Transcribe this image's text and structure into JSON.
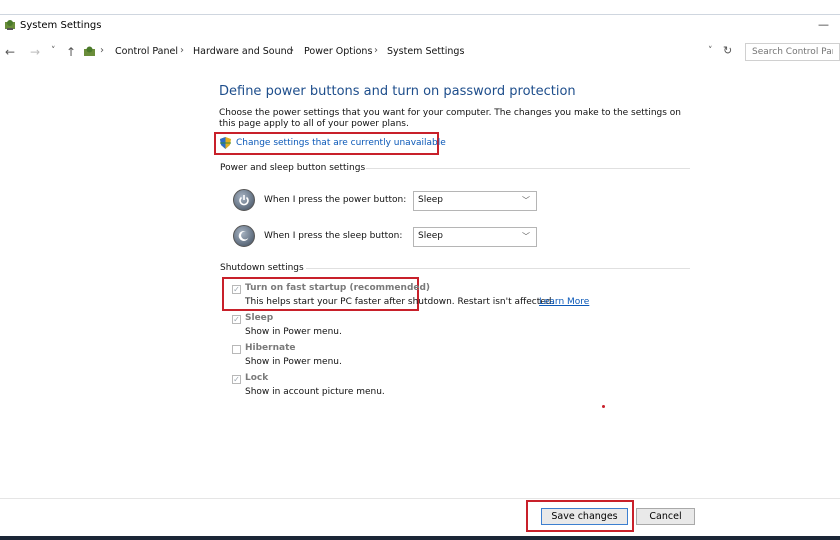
{
  "window": {
    "title": "System Settings",
    "minimize_glyph": "—"
  },
  "nav": {
    "back": "←",
    "forward": "→",
    "recent": "˅",
    "up": "↑",
    "refresh": "↻",
    "history": "˅"
  },
  "breadcrumb": [
    "Control Panel",
    "Hardware and Sound",
    "Power Options",
    "System Settings"
  ],
  "breadcrumb_sep": "›",
  "search": {
    "placeholder": "Search Control Par"
  },
  "main": {
    "heading": "Define power buttons and turn on password protection",
    "description": "Choose the power settings that you want for your computer. The changes you make to the settings on this page apply to all of your power plans.",
    "change_link": "Change settings that are currently unavailable"
  },
  "power_sleep": {
    "section_title": "Power and sleep button settings",
    "power_label": "When I press the power button:",
    "power_value": "Sleep",
    "sleep_label": "When I press the sleep button:",
    "sleep_value": "Sleep"
  },
  "shutdown": {
    "section_title": "Shutdown settings",
    "fast_startup": {
      "title": "Turn on fast startup (recommended)",
      "desc": "This helps start your PC faster after shutdown. Restart isn't affected.",
      "learn_more": "Learn More",
      "checked": true
    },
    "sleep": {
      "title": "Sleep",
      "desc": "Show in Power menu.",
      "checked": true
    },
    "hibernate": {
      "title": "Hibernate",
      "desc": "Show in Power menu.",
      "checked": false
    },
    "lock": {
      "title": "Lock",
      "desc": "Show in account picture menu.",
      "checked": true
    }
  },
  "buttons": {
    "save": "Save changes",
    "cancel": "Cancel"
  },
  "colors": {
    "highlight": "#c8202a",
    "heading": "#1e4e8c",
    "link": "#0a58b8"
  },
  "icons": [
    "app-icon",
    "shield-icon",
    "power-button-icon",
    "sleep-button-icon",
    "refresh-icon",
    "chevron-down-icon"
  ]
}
